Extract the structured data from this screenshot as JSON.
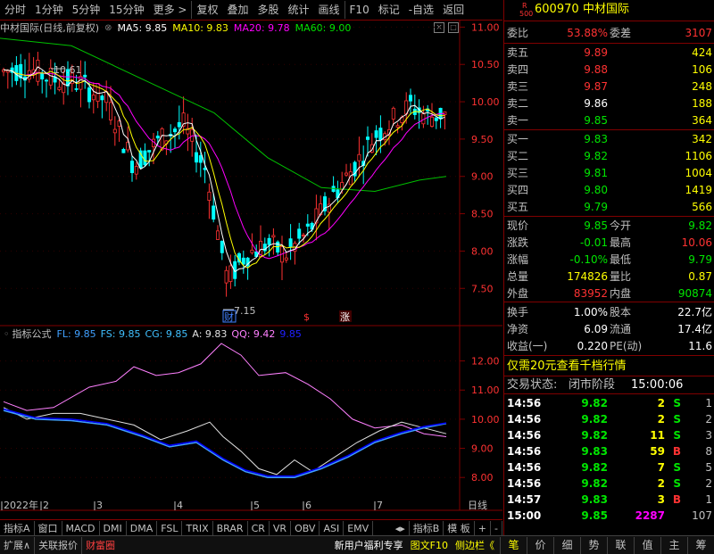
{
  "toolbar": {
    "items": [
      "分时",
      "1分钟",
      "5分钟",
      "15分钟",
      "更多 >",
      "复权",
      "叠加",
      "多股",
      "统计",
      "画线",
      "F10",
      "标记",
      "-自选",
      "返回"
    ]
  },
  "main_chart": {
    "stock_name": "中材国际(日线,前复权)",
    "ma5": "MA5: 9.85",
    "ma10": "MA10: 9.83",
    "ma20": "MA20: 9.78",
    "ma60": "MA60: 9.00",
    "high_label": "10.61",
    "low_label": "7.15",
    "marker_cai": "财",
    "marker_s": "$",
    "marker_zhang": "涨",
    "price_axis": [
      "11.00",
      "10.50",
      "10.00",
      "9.50",
      "9.00",
      "8.50",
      "8.00",
      "7.50"
    ]
  },
  "indicator": {
    "name": "指标公式",
    "fl": "FL: 9.85",
    "fs": "FS: 9.85",
    "cg": "CG: 9.85",
    "a": "A: 9.83",
    "qq": "QQ: 9.42",
    "last": "9.85",
    "axis": [
      "12.00",
      "11.00",
      "10.00",
      "9.00",
      "8.00"
    ]
  },
  "date_axis": {
    "labels": [
      "2022年",
      "2",
      "3",
      "4",
      "5",
      "6",
      "7"
    ],
    "period": "日线"
  },
  "indicator_tabs": [
    "指标A",
    "窗口",
    "MACD",
    "DMI",
    "DMA",
    "FSL",
    "TRIX",
    "BRAR",
    "CR",
    "VR",
    "OBV",
    "ASI",
    "EMV",
    "指标B",
    "模 板",
    "+",
    "-"
  ],
  "status_bar": {
    "left": [
      "扩展∧",
      "关联报价",
      "财富圈"
    ],
    "promo": "新用户福利专享",
    "f10": "图文F10",
    "sidebar": "侧边栏《",
    "bottom_tabs": [
      "笔",
      "价",
      "细",
      "势",
      "联",
      "值",
      "主",
      "筹"
    ]
  },
  "quote": {
    "r_badge": "R",
    "r_num": "500",
    "code": "600970",
    "name": "中材国际",
    "weibi_label": "委比",
    "weibi": "53.88%",
    "weicha_label": "委差",
    "weicha": "3107",
    "sell": [
      {
        "label": "卖五",
        "price": "9.89",
        "vol": "424"
      },
      {
        "label": "卖四",
        "price": "9.88",
        "vol": "106"
      },
      {
        "label": "卖三",
        "price": "9.87",
        "vol": "248"
      },
      {
        "label": "卖二",
        "price": "9.86",
        "vol": "188"
      },
      {
        "label": "卖一",
        "price": "9.85",
        "vol": "364"
      }
    ],
    "buy": [
      {
        "label": "买一",
        "price": "9.83",
        "vol": "342"
      },
      {
        "label": "买二",
        "price": "9.82",
        "vol": "1106"
      },
      {
        "label": "买三",
        "price": "9.81",
        "vol": "1004"
      },
      {
        "label": "买四",
        "price": "9.80",
        "vol": "1419"
      },
      {
        "label": "买五",
        "price": "9.79",
        "vol": "566"
      }
    ],
    "stats": [
      {
        "l1": "现价",
        "v1": "9.85",
        "l2": "今开",
        "v2": "9.82"
      },
      {
        "l1": "涨跌",
        "v1": "-0.01",
        "l2": "最高",
        "v2": "10.06"
      },
      {
        "l1": "涨幅",
        "v1": "-0.10%",
        "l2": "最低",
        "v2": "9.79"
      },
      {
        "l1": "总量",
        "v1": "174826",
        "l2": "量比",
        "v2": "0.87"
      },
      {
        "l1": "外盘",
        "v1": "83952",
        "l2": "内盘",
        "v2": "90874"
      }
    ],
    "stats2": [
      {
        "l1": "换手",
        "v1": "1.00%",
        "l2": "股本",
        "v2": "22.7亿"
      },
      {
        "l1": "净资",
        "v1": "6.09",
        "l2": "流通",
        "v2": "17.4亿"
      },
      {
        "l1": "收益(一)",
        "v1": "0.220",
        "l2": "PE(动)",
        "v2": "11.6"
      }
    ],
    "promo": "仅需20元查看千档行情",
    "trade_state_label": "交易状态:",
    "trade_state": "闭市阶段",
    "trade_time": "15:00:06",
    "ticks": [
      {
        "t": "14:56",
        "p": "9.82",
        "v": "2",
        "d": "S",
        "n": "1"
      },
      {
        "t": "14:56",
        "p": "9.82",
        "v": "2",
        "d": "S",
        "n": "2"
      },
      {
        "t": "14:56",
        "p": "9.82",
        "v": "11",
        "d": "S",
        "n": "3"
      },
      {
        "t": "14:56",
        "p": "9.83",
        "v": "59",
        "d": "B",
        "n": "8"
      },
      {
        "t": "14:56",
        "p": "9.82",
        "v": "7",
        "d": "S",
        "n": "5"
      },
      {
        "t": "14:56",
        "p": "9.82",
        "v": "2",
        "d": "S",
        "n": "2"
      },
      {
        "t": "14:57",
        "p": "9.83",
        "v": "3",
        "d": "B",
        "n": "1"
      },
      {
        "t": "15:00",
        "p": "9.85",
        "v": "2287",
        "d": "",
        "n": "107"
      }
    ]
  }
}
